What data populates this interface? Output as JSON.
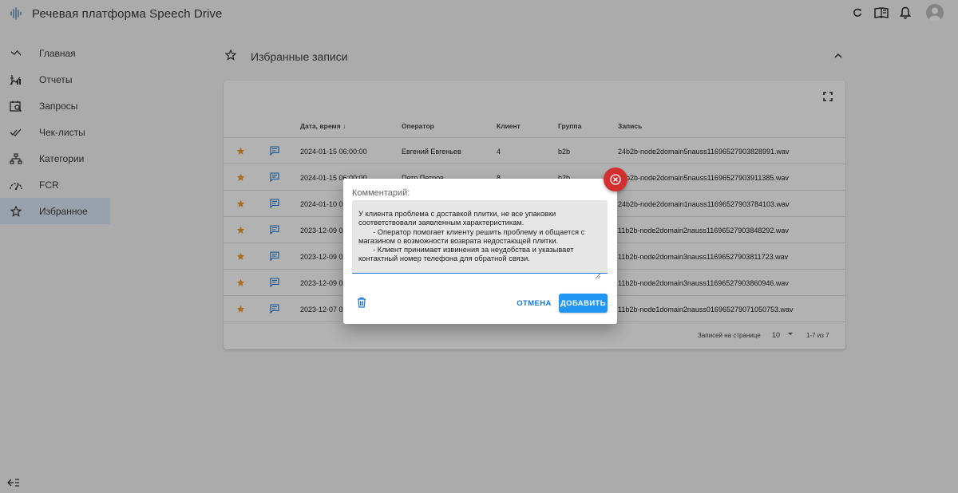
{
  "app": {
    "title": "Речевая платформа Speech Drive"
  },
  "top_icons": [
    "refresh-icon",
    "book-icon",
    "bell-icon",
    "avatar"
  ],
  "sidebar": {
    "items": [
      {
        "label": "Главная",
        "icon": "home-icon"
      },
      {
        "label": "Отчеты",
        "icon": "reports-icon"
      },
      {
        "label": "Запросы",
        "icon": "queries-icon"
      },
      {
        "label": "Чек-листы",
        "icon": "checklists-icon"
      },
      {
        "label": "Категории",
        "icon": "categories-icon"
      },
      {
        "label": "FCR",
        "icon": "fcr-icon"
      },
      {
        "label": "Избранное",
        "icon": "star-icon",
        "active": true
      }
    ]
  },
  "favorites": {
    "title": "Избранные записи",
    "columns": [
      "Дата, время",
      "Оператор",
      "Клиент",
      "Группа",
      "Запись"
    ],
    "rows": [
      {
        "datetime": "2024-01-15 06:00:00",
        "operator": "Евгений Евгеньев",
        "client": "4",
        "group": "b2b",
        "record": "24b2b-node2domain5nauss11696527903828991.wav"
      },
      {
        "datetime": "2024-01-15 06:00:00",
        "operator": "Петр Петров",
        "client": "8",
        "group": "b2b",
        "record": "24b2b-node2domain5nauss11696527903911385.wav"
      },
      {
        "datetime": "2024-01-10 06:00:00",
        "operator": "",
        "client": "",
        "group": "",
        "record": "24b2b-node2domain1nauss11696527903784103.wav"
      },
      {
        "datetime": "2023-12-09 02:00:00",
        "operator": "",
        "client": "",
        "group": "",
        "record": "11b2b-node2domain2nauss11696527903848292.wav"
      },
      {
        "datetime": "2023-12-09 02:00:00",
        "operator": "",
        "client": "",
        "group": "",
        "record": "11b2b-node2domain3nauss11696527903811723.wav"
      },
      {
        "datetime": "2023-12-09 02:00:00",
        "operator": "",
        "client": "",
        "group": "",
        "record": "11b2b-node2domain3nauss11696527903860946.wav"
      },
      {
        "datetime": "2023-12-07 02:00:00",
        "operator": "",
        "client": "",
        "group": "",
        "record": "11b2b-node1domain2nauss016965279071050753.wav"
      }
    ],
    "pagination": {
      "rows_per_page_label": "Записей на странице",
      "rows_per_page": "10",
      "range": "1-7 из 7"
    }
  },
  "dialog": {
    "label": "Комментарий:",
    "comment": "У клиента проблема с доставкой плитки, не все упаковки соответствовали заявленным характеристикам.\n       - Оператор помогает клиенту решить проблему и общается с магазином о возможности возврата недостающей плитки.\n       - Клиент принимает извинения за неудобства и указывает контактный номер телефона для обратной связи.",
    "cancel_label": "ОТМЕНА",
    "add_label": "ДОБАВИТЬ"
  },
  "colors": {
    "accent": "#2196f3",
    "primary": "#1976d2",
    "star": "#f39c2b",
    "close": "#d32f2f",
    "active_nav": "#dbe8f7"
  }
}
